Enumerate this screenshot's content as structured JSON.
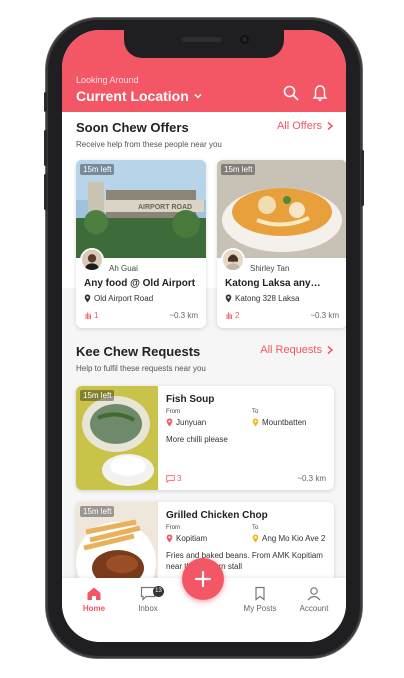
{
  "header": {
    "subtitle": "Looking Around",
    "location": "Current Location",
    "bg_color": "#f35664"
  },
  "offers": {
    "title": "Soon Chew Offers",
    "subtitle": "Receive help from these people near you",
    "link": "All Offers",
    "cards": [
      {
        "time_left": "15m left",
        "user": "Ah Guai",
        "title": "Any food @ Old Airport",
        "location": "Old Airport Road",
        "count": "1",
        "distance": "~0.3 km"
      },
      {
        "time_left": "15m left",
        "user": "Shirley Tan",
        "title": "Katong Laksa any…",
        "location": "Katong 328 Laksa",
        "count": "2",
        "distance": "~0.3 km"
      }
    ]
  },
  "requests": {
    "title": "Kee Chew Requests",
    "subtitle": "Help to fulfil these requests near you",
    "link": "All Requests",
    "items": [
      {
        "time_left": "15m left",
        "title": "Fish Soup",
        "from_label": "From",
        "from": "Junyuan",
        "to_label": "To",
        "to": "Mountbatten",
        "note": "More chilli please",
        "count": "3",
        "distance": "~0.3 km"
      },
      {
        "time_left": "15m left",
        "title": "Grilled Chicken Chop",
        "from_label": "From",
        "from": "Kopitiam",
        "to_label": "To",
        "to": "Ang Mo Kio Ave 2",
        "note": "Fries and baked beans. From AMK Kopitiam near the western stall"
      }
    ]
  },
  "tabbar": {
    "home": "Home",
    "inbox": "Inbox",
    "inbox_badge": "13",
    "my_posts": "My Posts",
    "account": "Account"
  },
  "icons": {
    "search": "search-icon",
    "bell": "bell-icon",
    "chevron": "chevron-down-icon",
    "pin": "location-pin-icon",
    "hand": "hand-icon",
    "chat": "chat-icon",
    "plus": "plus-icon"
  }
}
